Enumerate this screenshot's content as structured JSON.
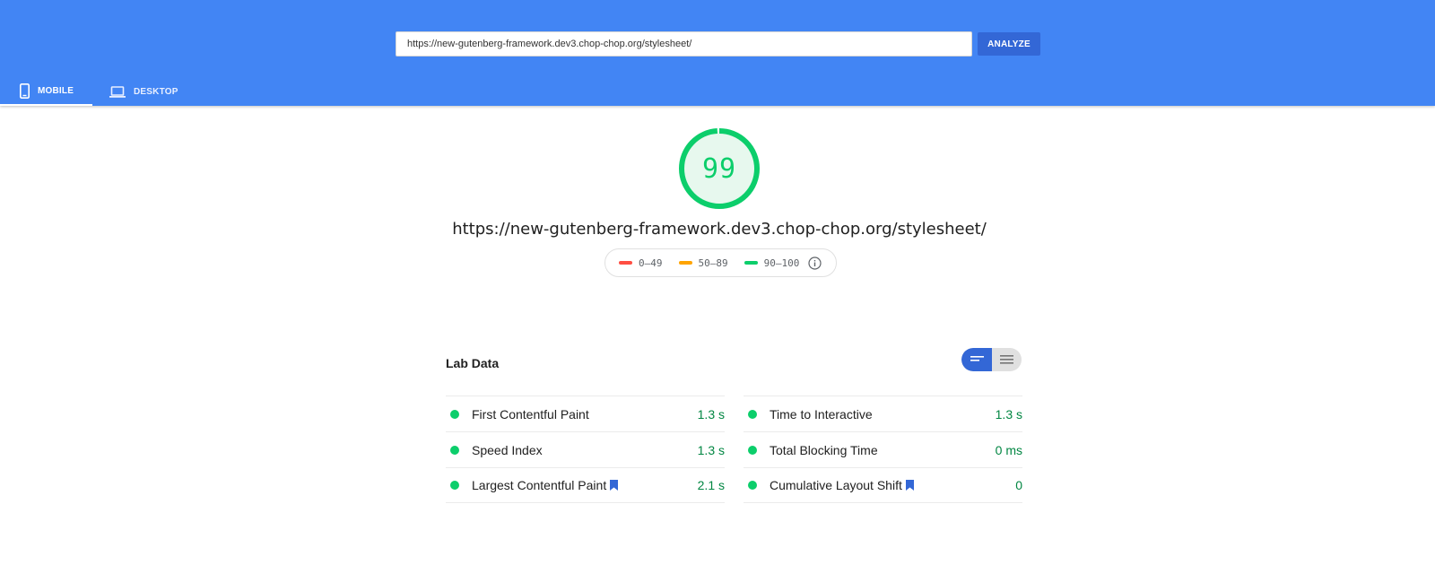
{
  "header": {
    "url_value": "https://new-gutenberg-framework.dev3.chop-chop.org/stylesheet/",
    "analyze_label": "ANALYZE",
    "tabs": [
      {
        "label": "MOBILE",
        "icon": "phone-icon",
        "active": true
      },
      {
        "label": "DESKTOP",
        "icon": "laptop-icon",
        "active": false
      }
    ]
  },
  "score": {
    "value": "99",
    "fraction": 0.99,
    "color": "#0cce6b",
    "url": "https://new-gutenberg-framework.dev3.chop-chop.org/stylesheet/"
  },
  "legend": {
    "items": [
      {
        "label": "0–49",
        "color": "#ff4e42"
      },
      {
        "label": "50–89",
        "color": "#ffa400"
      },
      {
        "label": "90–100",
        "color": "#0cce6b"
      }
    ],
    "info_icon": "info-icon"
  },
  "lab_data": {
    "title": "Lab Data",
    "toggle": {
      "active": "expanded-view",
      "icons": [
        "collapsed-view-icon",
        "expanded-view-icon"
      ]
    },
    "metrics_left": [
      {
        "label": "First Contentful Paint",
        "value": "1.3 s",
        "bookmark": false
      },
      {
        "label": "Speed Index",
        "value": "1.3 s",
        "bookmark": false
      },
      {
        "label": "Largest Contentful Paint",
        "value": "2.1 s",
        "bookmark": true
      }
    ],
    "metrics_right": [
      {
        "label": "Time to Interactive",
        "value": "1.3 s",
        "bookmark": false
      },
      {
        "label": "Total Blocking Time",
        "value": "0 ms",
        "bookmark": false
      },
      {
        "label": "Cumulative Layout Shift",
        "value": "0",
        "bookmark": true
      }
    ]
  },
  "colors": {
    "header_bg": "#4285f4",
    "button_bg": "#3367d6",
    "pass_green": "#0cce6b",
    "value_green": "#018642",
    "bookmark_blue": "#3367d6"
  }
}
